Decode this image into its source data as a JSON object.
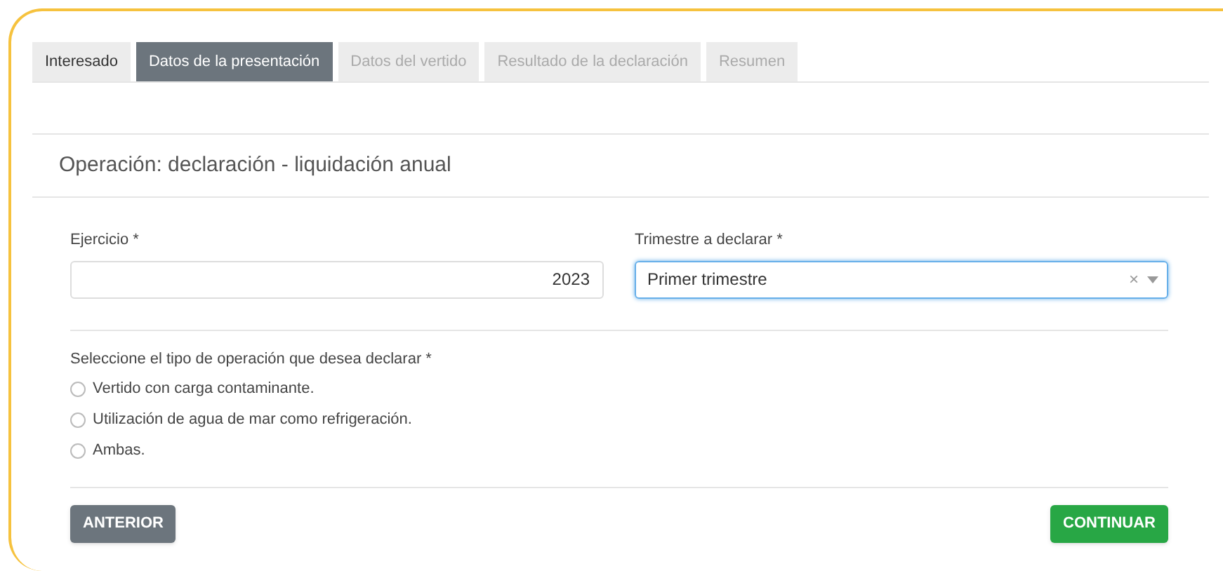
{
  "tabs": [
    {
      "label": "Interesado",
      "selected": false,
      "disabled": false
    },
    {
      "label": "Datos de la presentación",
      "selected": true,
      "disabled": false
    },
    {
      "label": "Datos del vertido",
      "selected": false,
      "disabled": true
    },
    {
      "label": "Resultado de la declaración",
      "selected": false,
      "disabled": true
    },
    {
      "label": "Resumen",
      "selected": false,
      "disabled": true
    }
  ],
  "heading": "Operación: declaración - liquidación anual",
  "ejercicio": {
    "label": "Ejercicio *",
    "value": "2023"
  },
  "trimestre": {
    "label": "Trimestre a declarar *",
    "value": "Primer trimestre",
    "clear": "×"
  },
  "operation": {
    "label": "Seleccione el tipo de operación que desea declarar *",
    "options": [
      {
        "label": "Vertido con carga contaminante.",
        "selected": false
      },
      {
        "label": "Utilización de agua de mar como refrigeración.",
        "selected": false
      },
      {
        "label": "Ambas.",
        "selected": false
      }
    ]
  },
  "buttons": {
    "back": "ANTERIOR",
    "next": "CONTINUAR"
  }
}
